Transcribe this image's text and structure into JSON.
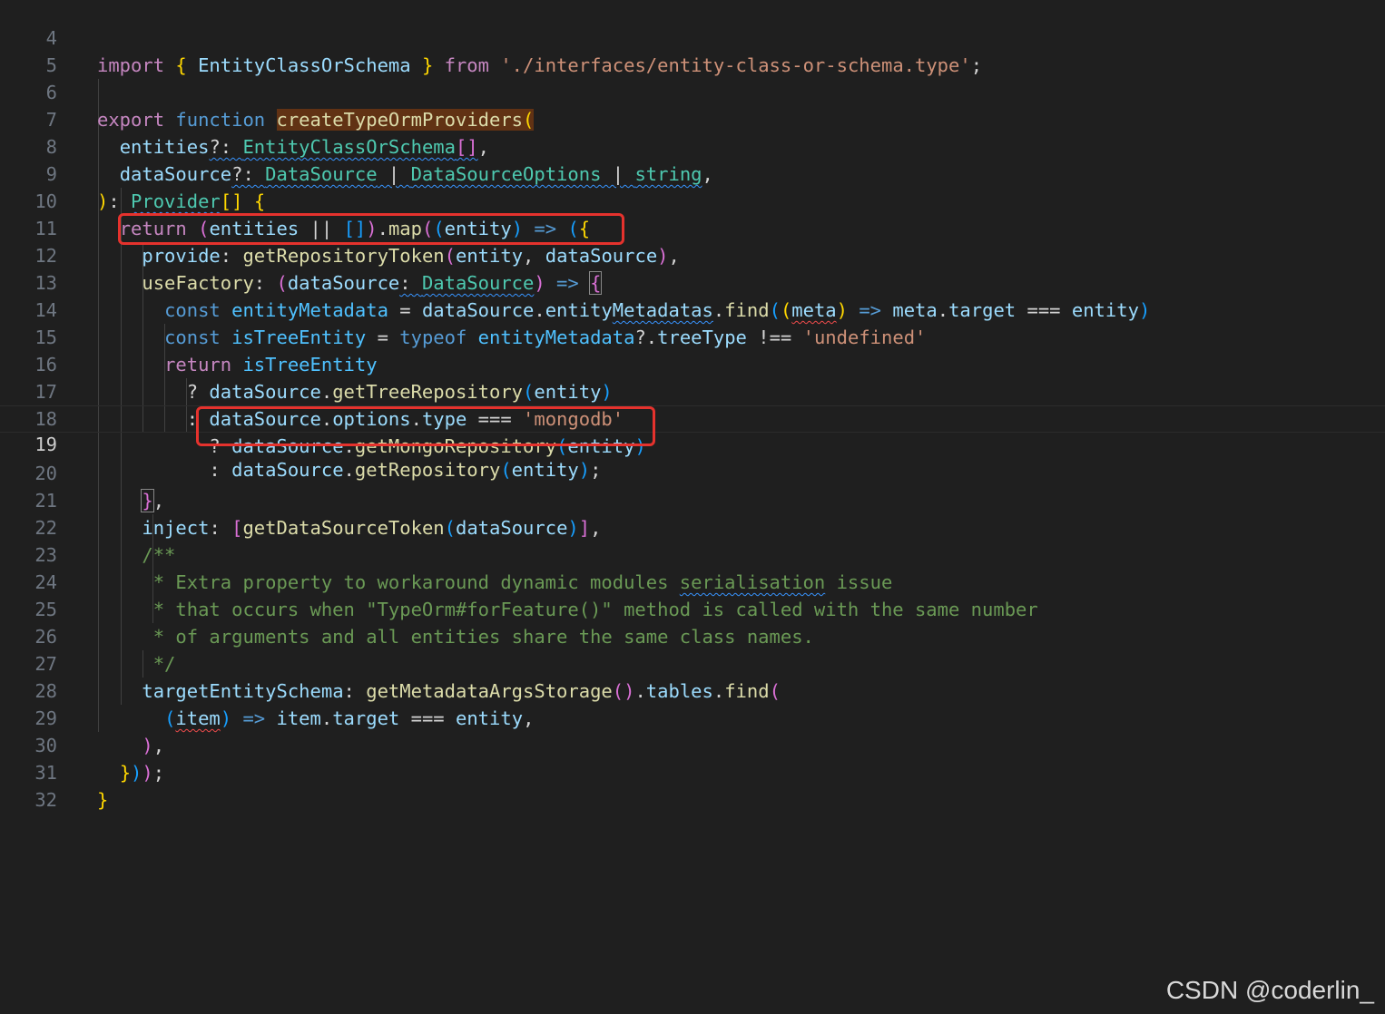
{
  "editor": {
    "active_line": "19",
    "lines": [
      {
        "num": "4",
        "text": "import { EntityClassOrSchema } from './interfaces/entity-class-or-schema.type';"
      },
      {
        "num": "5",
        "text": ""
      },
      {
        "num": "6",
        "text": "export function createTypeOrmProviders("
      },
      {
        "num": "7",
        "text": "  entities?: EntityClassOrSchema[],"
      },
      {
        "num": "8",
        "text": "  dataSource?: DataSource | DataSourceOptions | string,"
      },
      {
        "num": "9",
        "text": "): Provider[] {"
      },
      {
        "num": "10",
        "text": "  return (entities || []).map((entity) => ({"
      },
      {
        "num": "11",
        "text": "    provide: getRepositoryToken(entity, dataSource),"
      },
      {
        "num": "12",
        "text": "    useFactory: (dataSource: DataSource) => {"
      },
      {
        "num": "13",
        "text": "      const entityMetadata = dataSource.entityMetadatas.find((meta) => meta.target === entity)"
      },
      {
        "num": "14",
        "text": "      const isTreeEntity = typeof entityMetadata?.treeType !== 'undefined'"
      },
      {
        "num": "15",
        "text": "      return isTreeEntity"
      },
      {
        "num": "16",
        "text": "        ? dataSource.getTreeRepository(entity)"
      },
      {
        "num": "17",
        "text": "        : dataSource.options.type === 'mongodb'"
      },
      {
        "num": "18",
        "text": "          ? dataSource.getMongoRepository(entity)"
      },
      {
        "num": "19",
        "text": "          : dataSource.getRepository(entity);"
      },
      {
        "num": "20",
        "text": "    },"
      },
      {
        "num": "21",
        "text": "    inject: [getDataSourceToken(dataSource)],"
      },
      {
        "num": "22",
        "text": "    /**"
      },
      {
        "num": "23",
        "text": "     * Extra property to workaround dynamic modules serialisation issue"
      },
      {
        "num": "24",
        "text": "     * that occurs when \"TypeOrm#forFeature()\" method is called with the same number"
      },
      {
        "num": "25",
        "text": "     * of arguments and all entities share the same class names."
      },
      {
        "num": "26",
        "text": "     */"
      },
      {
        "num": "27",
        "text": "    targetEntitySchema: getMetadataArgsStorage().tables.find("
      },
      {
        "num": "28",
        "text": "      (item) => item.target === entity,"
      },
      {
        "num": "29",
        "text": "    ),"
      },
      {
        "num": "30",
        "text": "  }));"
      },
      {
        "num": "31",
        "text": "}"
      },
      {
        "num": "32",
        "text": ""
      }
    ]
  },
  "watermark": "CSDN @coderlin_",
  "colors": {
    "background": "#1f1f1f",
    "annotation_box": "#e5322d",
    "keyword": "#c586c0",
    "storage": "#569cd6",
    "function": "#dcdcaa",
    "type": "#4ec9b0",
    "variable": "#9cdcfe",
    "string": "#ce9178",
    "comment": "#6a9955"
  }
}
